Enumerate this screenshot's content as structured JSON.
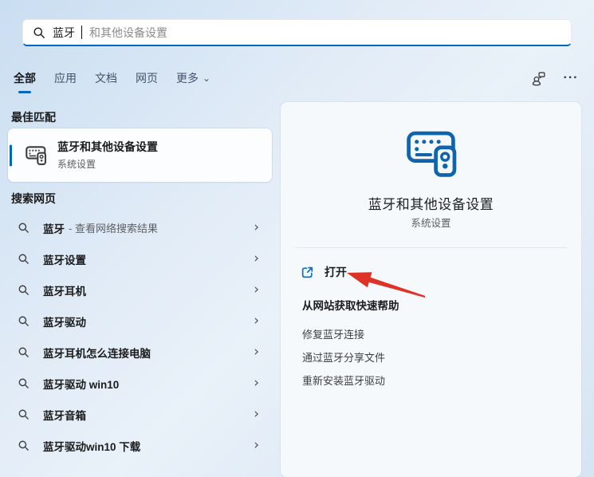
{
  "colors": {
    "accent": "#0067c0",
    "icon_blue": "#0f64ad",
    "arrow_red": "#de3226"
  },
  "search": {
    "typed": "蓝牙",
    "suggestion": "和其他设备设置"
  },
  "tabs": {
    "items": [
      {
        "label": "全部",
        "active": true
      },
      {
        "label": "应用"
      },
      {
        "label": "文档"
      },
      {
        "label": "网页"
      },
      {
        "label": "更多",
        "has_chevron": true
      }
    ],
    "chevron_down_glyph": "⌄",
    "more_options_glyph": "···"
  },
  "best_match": {
    "header": "最佳匹配",
    "title": "蓝牙和其他设备设置",
    "subtitle": "系统设置"
  },
  "web_search": {
    "header": "搜索网页",
    "chevron_glyph": "›",
    "results": [
      {
        "query": "蓝牙",
        "annotation": "- 查看网络搜索结果"
      },
      {
        "query": "蓝牙设置"
      },
      {
        "query": "蓝牙耳机"
      },
      {
        "query": "蓝牙驱动"
      },
      {
        "query": "蓝牙耳机怎么连接电脑"
      },
      {
        "query": "蓝牙驱动 win10"
      },
      {
        "query": "蓝牙音箱"
      },
      {
        "query": "蓝牙驱动win10 下载"
      }
    ]
  },
  "preview": {
    "title": "蓝牙和其他设备设置",
    "subtitle": "系统设置",
    "open_label": "打开",
    "help_header": "从网站获取快速帮助",
    "links": [
      "修复蓝牙连接",
      "通过蓝牙分享文件",
      "重新安装蓝牙驱动"
    ]
  }
}
